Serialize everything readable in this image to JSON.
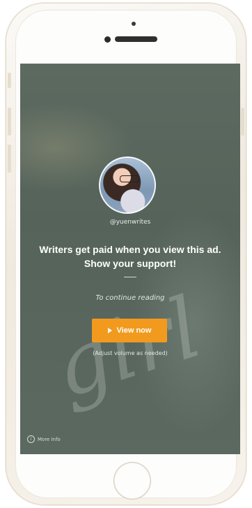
{
  "ad": {
    "username": "@yuenwrites",
    "headline": "Writers get paid when you view this ad. Show your support!",
    "continue_text": "To continue reading",
    "button_label": "View now",
    "adjust_text": "(Adjust volume as needed)",
    "more_info": "More Info"
  },
  "colors": {
    "accent": "#f29a1e",
    "screen_bg": "#5d6a60"
  },
  "icons": {
    "play": "play-icon",
    "info": "info-icon"
  }
}
